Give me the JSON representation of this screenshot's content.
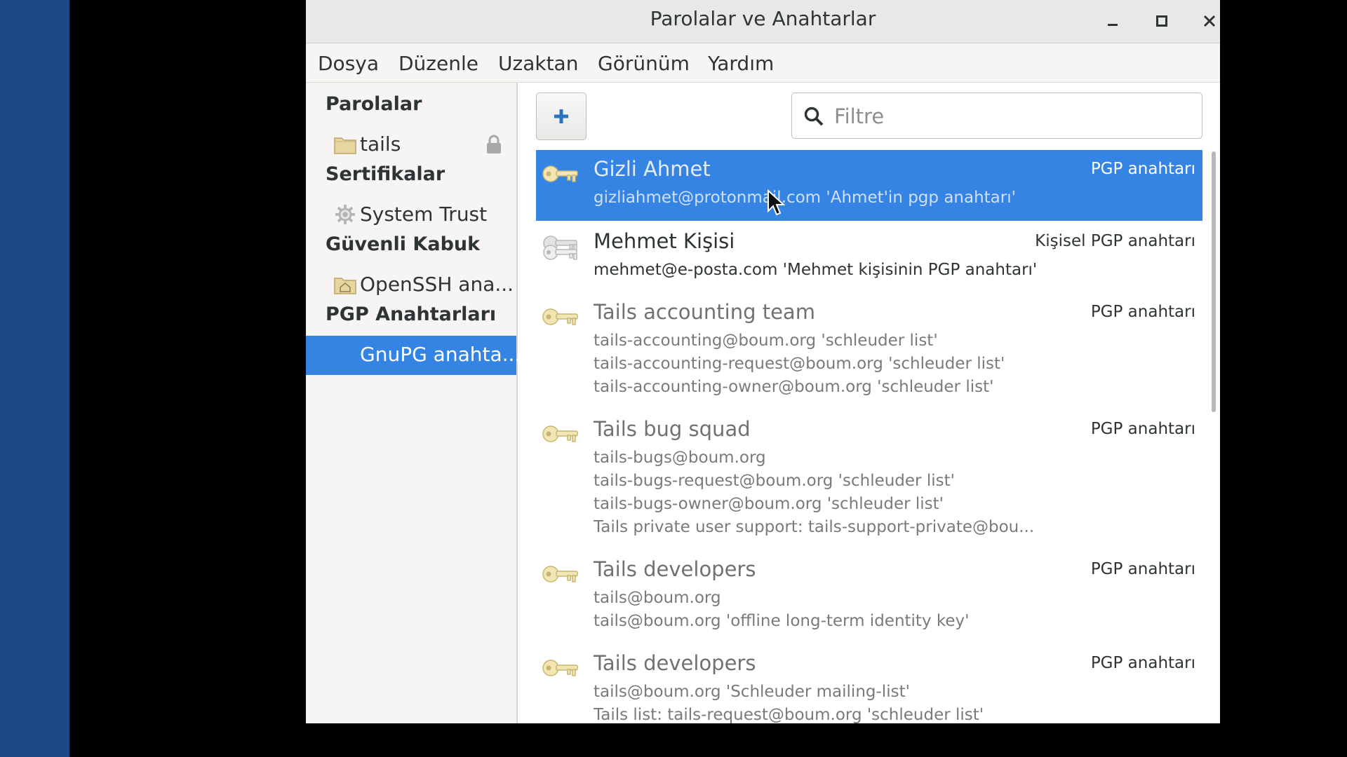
{
  "window": {
    "title": "Parolalar ve Anahtarlar",
    "controls": [
      "minimize-icon",
      "maximize-icon",
      "close-icon"
    ]
  },
  "menu": [
    "Dosya",
    "Düzenle",
    "Uzaktan",
    "Görünüm",
    "Yardım"
  ],
  "sidebar": {
    "sections": [
      {
        "header": "Parolalar",
        "items": [
          {
            "label": "tails",
            "icon": "folder-icon",
            "locked": true
          }
        ]
      },
      {
        "header": "Sertifikalar",
        "items": [
          {
            "label": "System Trust",
            "icon": "gear-icon"
          }
        ]
      },
      {
        "header": "Güvenli Kabuk",
        "items": [
          {
            "label": "OpenSSH ana...",
            "icon": "home-folder-icon"
          }
        ]
      },
      {
        "header": "PGP Anahtarları",
        "items": [
          {
            "label": "GnuPG anahta...",
            "selected": true
          }
        ]
      }
    ]
  },
  "toolbar": {
    "add_icon": "plus-icon",
    "filter_placeholder": "Filtre",
    "filter_value": ""
  },
  "keys": [
    {
      "name": "Gizli Ahmet",
      "type": "PGP anahtarı",
      "icon": "key-icon",
      "selected": true,
      "lines": [
        "gizliahmet@protonmail.com 'Ahmet'in pgp anahtarı'"
      ]
    },
    {
      "name": "Mehmet Kişisi",
      "type": "Kişisel PGP anahtarı",
      "icon": "keypair-icon",
      "lines": [
        "mehmet@e-posta.com 'Mehmet kişisinin PGP anahtarı'"
      ]
    },
    {
      "name": "Tails accounting team",
      "type": "PGP anahtarı",
      "icon": "key-icon",
      "lines": [
        "tails-accounting@boum.org 'schleuder list'",
        "tails-accounting-request@boum.org 'schleuder list'",
        "tails-accounting-owner@boum.org 'schleuder list'"
      ]
    },
    {
      "name": "Tails bug squad",
      "type": "PGP anahtarı",
      "icon": "key-icon",
      "lines": [
        "tails-bugs@boum.org",
        "tails-bugs-request@boum.org 'schleuder list'",
        "tails-bugs-owner@boum.org 'schleuder list'",
        "Tails private user support: tails-support-private@bou..."
      ]
    },
    {
      "name": "Tails developers",
      "type": "PGP anahtarı",
      "icon": "key-icon",
      "lines": [
        "tails@boum.org",
        "tails@boum.org 'offline long-term identity key'"
      ]
    },
    {
      "name": "Tails developers",
      "type": "PGP anahtarı",
      "icon": "key-icon",
      "lines": [
        "tails@boum.org 'Schleuder mailing-list'",
        "Tails list: tails-request@boum.org 'schleuder list'"
      ]
    }
  ]
}
